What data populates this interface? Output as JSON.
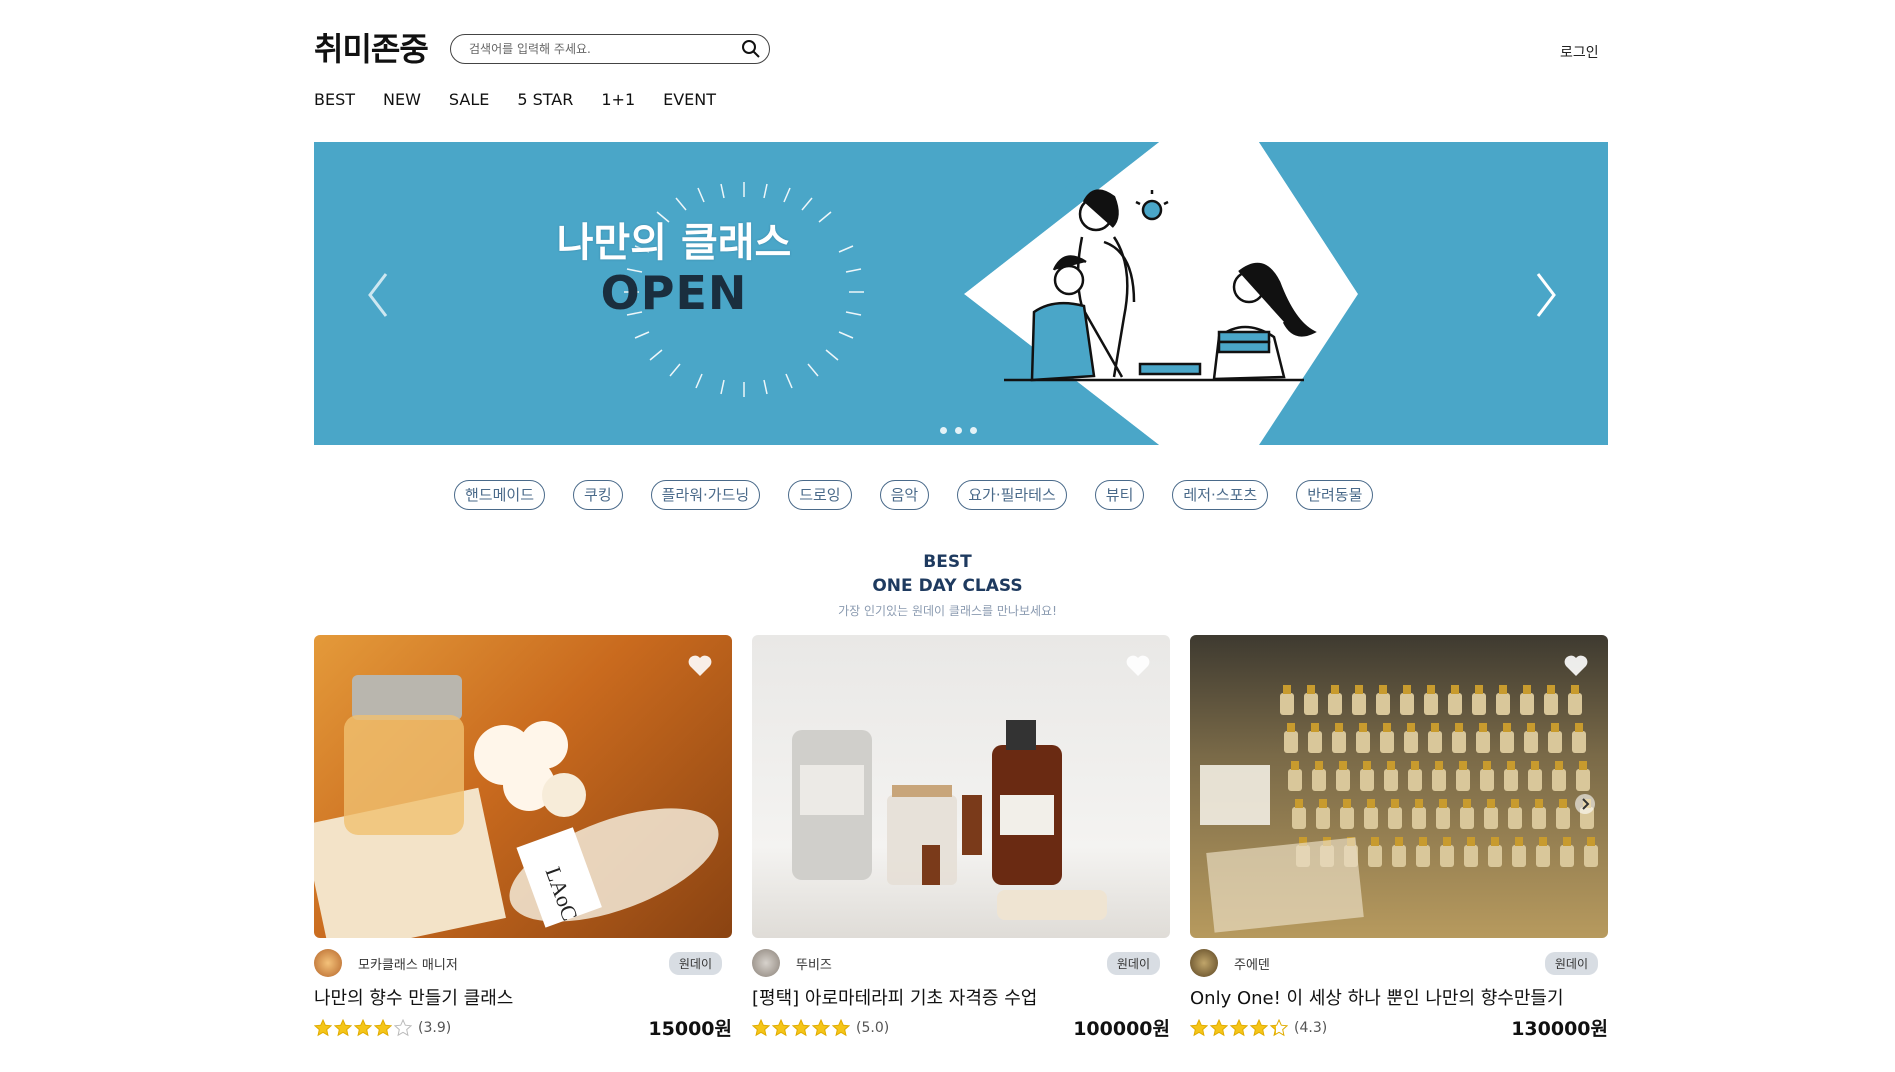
{
  "header": {
    "logo": "취미존중",
    "search_placeholder": "검색어를 입력해 주세요.",
    "login": "로그인"
  },
  "nav": [
    "BEST",
    "NEW",
    "SALE",
    "5 STAR",
    "1+1",
    "EVENT"
  ],
  "banner": {
    "headline": "나만의 클래스",
    "subheadline": "OPEN",
    "background": "#4aa6c8",
    "slide_count": 3
  },
  "categories": [
    "핸드메이드",
    "쿠킹",
    "플라워·가드닝",
    "드로잉",
    "음악",
    "요가·필라테스",
    "뷰티",
    "레저·스포츠",
    "반려동물"
  ],
  "section": {
    "line1": "BEST",
    "line2": "ONE DAY CLASS",
    "subtitle": "가장 인기있는 원데이 클래스를 만나보세요!"
  },
  "cards": [
    {
      "host": "모카클래스 매니저",
      "badge": "원데이",
      "title": "나만의 향수 만들기 클래스",
      "rating_text": "(3.9)",
      "rating": 3.9,
      "price": "15000원",
      "image_label": "LAoC"
    },
    {
      "host": "뚜비즈",
      "badge": "원데이",
      "title": "[평택] 아로마테라피 기초 자격증 수업",
      "rating_text": "(5.0)",
      "rating": 5.0,
      "price": "100000원",
      "image_label": ""
    },
    {
      "host": "주에덴",
      "badge": "원데이",
      "title": "Only One! 이 세상 하나 뿐인 나만의 향수만들기",
      "rating_text": "(4.3)",
      "rating": 4.3,
      "price": "130000원",
      "image_label": ""
    }
  ],
  "colors": {
    "accent": "#1e3a5f",
    "star": "#f5c518",
    "category_border": "#4a6a8a"
  }
}
